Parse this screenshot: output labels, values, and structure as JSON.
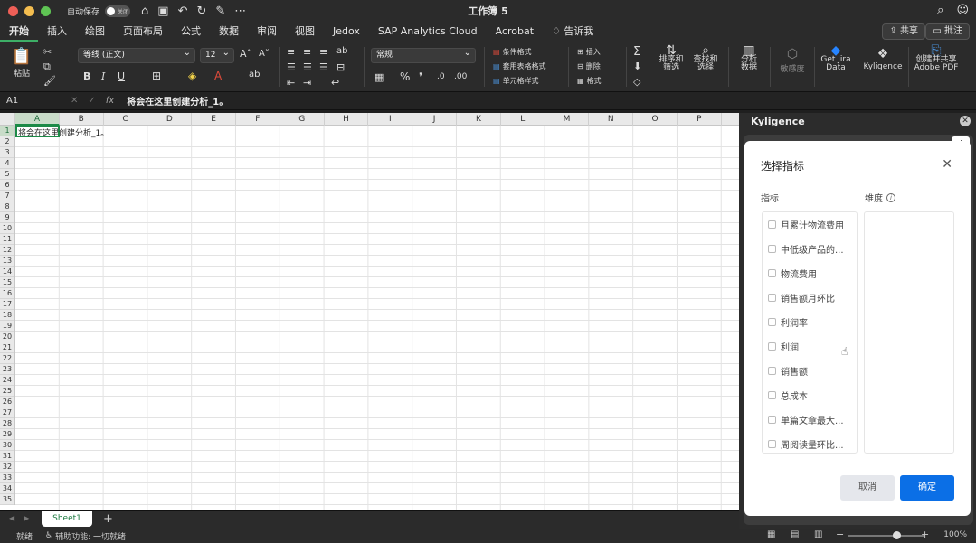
{
  "titlebar": {
    "autosave_label": "自动保存",
    "toggle_state": "关闭",
    "title": "工作簿 5"
  },
  "ribbon_tabs": [
    "开始",
    "插入",
    "绘图",
    "页面布局",
    "公式",
    "数据",
    "审阅",
    "视图",
    "Jedox",
    "SAP Analytics Cloud",
    "Acrobat"
  ],
  "tell_me": "告诉我",
  "share_label": "共享",
  "comment_label": "批注",
  "ribbon": {
    "paste_label": "粘贴",
    "font_name": "等线 (正文)",
    "font_size": "12",
    "number_format": "常规",
    "conditional_format": "条件格式",
    "table_format": "套用表格格式",
    "cell_style": "单元格样式",
    "insert": "插入",
    "delete": "删除",
    "format": "格式",
    "sort_filter": "排序和\n筛选",
    "find_select": "查找和\n选择",
    "analyze_data": "分析\n数据",
    "sensitivity": "敏感度",
    "get_jira": "Get Jira\nData",
    "kyligence": "Kyligence",
    "adobe_pdf": "创建并共享\nAdobe PDF"
  },
  "formula_bar": {
    "name_box": "A1",
    "fx": "fx",
    "content": "将会在这里创建分析_1。"
  },
  "grid": {
    "columns": [
      "A",
      "B",
      "C",
      "D",
      "E",
      "F",
      "G",
      "H",
      "I",
      "J",
      "K",
      "L",
      "M",
      "N",
      "O",
      "P"
    ],
    "rows": [
      "1",
      "2",
      "3",
      "4",
      "5",
      "6",
      "7",
      "8",
      "9",
      "10",
      "11",
      "12",
      "13",
      "14",
      "15",
      "16",
      "17",
      "18",
      "19",
      "20",
      "21",
      "22",
      "23",
      "24",
      "25",
      "26",
      "27",
      "28",
      "29",
      "30",
      "31",
      "32",
      "33",
      "34",
      "35"
    ],
    "a1_value": "将会在这里创建分析_1。"
  },
  "sheet_tab": "Sheet1",
  "status": {
    "ready": "就绪",
    "accessibility": "辅助功能: 一切就绪",
    "zoom": "100%"
  },
  "pane": {
    "title": "Kyligence"
  },
  "modal": {
    "title": "选择指标",
    "metrics_label": "指标",
    "dimensions_label": "维度",
    "metrics": [
      "月累计物流费用",
      "中低级产品的...",
      "物流费用",
      "销售额月环比",
      "利润率",
      "利润",
      "销售额",
      "总成本",
      "单篇文章最大...",
      "周阅读量环比..."
    ],
    "cancel": "取消",
    "ok": "确定"
  }
}
